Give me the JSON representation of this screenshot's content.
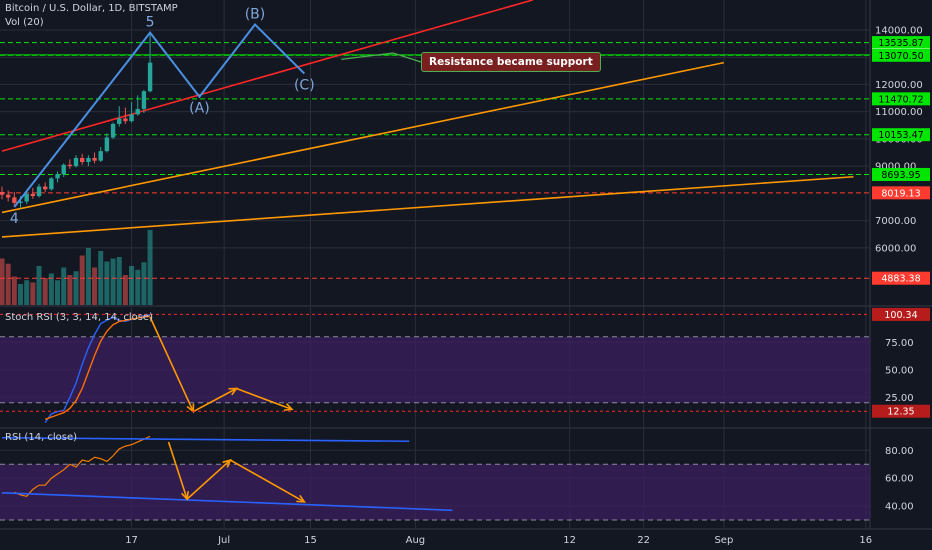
{
  "header": {
    "symbol_title": "Bitcoin / U.S. Dollar, 1D, BITSTAMP",
    "vol_label": "Vol (20)",
    "stoch_label": "Stoch RSI (3, 3, 14, 14, close)",
    "rsi_label": "RSI (14, close)"
  },
  "colors": {
    "background": "#131722",
    "grid": "#2a2e39",
    "up_candle": "#26a69a",
    "down_candle": "#ef5350",
    "green_level": "#00e600",
    "red_level": "#ff3b30",
    "channel_red": "#ff2626",
    "channel_orange": "#ff9800",
    "wave_line": "#4a90e2",
    "indicator_band": "#3b1f5e",
    "stoch_k": "#2962ff",
    "stoch_d": "#ff6d00",
    "rsi_line": "#f57c00",
    "projection_arrow": "#ff9800",
    "annotation_bg": "#7a1f1f"
  },
  "chart_data": {
    "type": "candlestick",
    "price_axis": {
      "ylim": [
        3900,
        15100
      ],
      "ticks": [
        6000,
        7000,
        9000,
        10000,
        11000,
        12000,
        13000,
        14000
      ],
      "tick_labels": [
        "6000.00",
        "7000.00",
        "9000.00",
        "10000.00",
        "11000.00",
        "12000.00",
        "13000.00",
        "14000.00"
      ]
    },
    "time_axis": {
      "labels": [
        "17",
        "Jul",
        "15",
        "Aug",
        "12",
        "22",
        "Sep",
        "16"
      ],
      "label_day": [
        21,
        36,
        50,
        67,
        92,
        104,
        117,
        140
      ]
    },
    "price_levels": [
      {
        "value": 13535.87,
        "label": "13535.87",
        "style": "green"
      },
      {
        "value": 13086.95,
        "label": "13086.95",
        "style": "green-solid"
      },
      {
        "value": 13070.5,
        "label": "13070.50",
        "style": "green"
      },
      {
        "value": 11470.72,
        "label": "11470.72",
        "style": "green"
      },
      {
        "value": 10153.47,
        "label": "10153.47",
        "style": "green"
      },
      {
        "value": 8693.95,
        "label": "8693.95",
        "style": "green"
      },
      {
        "value": 8019.13,
        "label": "8019.13",
        "style": "red"
      },
      {
        "value": 4883.38,
        "label": "4883.38",
        "style": "red"
      }
    ],
    "candles": [
      {
        "day": 0,
        "o": 8050,
        "h": 8250,
        "l": 7780,
        "c": 7950
      },
      {
        "day": 1,
        "o": 7950,
        "h": 8100,
        "l": 7700,
        "c": 7850
      },
      {
        "day": 2,
        "o": 7850,
        "h": 8050,
        "l": 7500,
        "c": 7650
      },
      {
        "day": 3,
        "o": 7650,
        "h": 7900,
        "l": 7450,
        "c": 7700
      },
      {
        "day": 4,
        "o": 7700,
        "h": 8100,
        "l": 7600,
        "c": 7980
      },
      {
        "day": 5,
        "o": 7980,
        "h": 8200,
        "l": 7800,
        "c": 7900
      },
      {
        "day": 6,
        "o": 7900,
        "h": 8350,
        "l": 7850,
        "c": 8250
      },
      {
        "day": 7,
        "o": 8250,
        "h": 8400,
        "l": 8050,
        "c": 8150
      },
      {
        "day": 8,
        "o": 8150,
        "h": 8600,
        "l": 8100,
        "c": 8550
      },
      {
        "day": 9,
        "o": 8550,
        "h": 8800,
        "l": 8400,
        "c": 8700
      },
      {
        "day": 10,
        "o": 8700,
        "h": 9100,
        "l": 8600,
        "c": 9050
      },
      {
        "day": 11,
        "o": 9050,
        "h": 9250,
        "l": 8900,
        "c": 9000
      },
      {
        "day": 12,
        "o": 9000,
        "h": 9400,
        "l": 8950,
        "c": 9300
      },
      {
        "day": 13,
        "o": 9300,
        "h": 9450,
        "l": 9050,
        "c": 9150
      },
      {
        "day": 14,
        "o": 9150,
        "h": 9400,
        "l": 9000,
        "c": 9300
      },
      {
        "day": 15,
        "o": 9300,
        "h": 9500,
        "l": 9100,
        "c": 9200
      },
      {
        "day": 16,
        "o": 9200,
        "h": 9700,
        "l": 9150,
        "c": 9550
      },
      {
        "day": 17,
        "o": 9550,
        "h": 10200,
        "l": 9500,
        "c": 10050
      },
      {
        "day": 18,
        "o": 10050,
        "h": 10600,
        "l": 10000,
        "c": 10550
      },
      {
        "day": 19,
        "o": 10550,
        "h": 11200,
        "l": 10450,
        "c": 10750
      },
      {
        "day": 20,
        "o": 10750,
        "h": 11150,
        "l": 10550,
        "c": 10650
      },
      {
        "day": 21,
        "o": 10650,
        "h": 11350,
        "l": 10600,
        "c": 10900
      },
      {
        "day": 22,
        "o": 10900,
        "h": 11600,
        "l": 10850,
        "c": 11100
      },
      {
        "day": 23,
        "o": 11100,
        "h": 11800,
        "l": 10950,
        "c": 11750
      },
      {
        "day": 24,
        "o": 11750,
        "h": 13900,
        "l": 11700,
        "c": 12800
      }
    ],
    "volume": [
      0.62,
      0.55,
      0.38,
      0.28,
      0.33,
      0.3,
      0.52,
      0.36,
      0.42,
      0.33,
      0.5,
      0.4,
      0.45,
      0.66,
      0.76,
      0.5,
      0.72,
      0.58,
      0.62,
      0.64,
      0.4,
      0.52,
      0.47,
      0.57,
      1.0
    ],
    "wave": {
      "points": [
        {
          "day": 2,
          "price": 7500,
          "label": "4"
        },
        {
          "day": 24,
          "price": 13900,
          "label": "5"
        },
        {
          "day": 32,
          "price": 11550,
          "label": "(A)"
        },
        {
          "day": 41,
          "price": 14200,
          "label": "(B)"
        },
        {
          "day": 49,
          "price": 12400,
          "label": "(C)"
        }
      ]
    },
    "trendlines": [
      {
        "name": "channel-red",
        "p1": {
          "day": 0,
          "price": 9550
        },
        "p2": {
          "day": 86,
          "price": 15100
        }
      },
      {
        "name": "channel-orange-upper",
        "p1": {
          "day": 0,
          "price": 7300
        },
        "p2": {
          "day": 117,
          "price": 12800
        }
      },
      {
        "name": "channel-orange-lower",
        "p1": {
          "day": 0,
          "price": 6400
        },
        "p2": {
          "day": 138,
          "price": 8610
        }
      }
    ],
    "annotation": {
      "text": "Resistance became support",
      "anchor_day": 55,
      "anchor_price": 12920
    },
    "stoch_rsi": {
      "ylim": [
        -2,
        108
      ],
      "ticks": [
        25,
        50,
        75
      ],
      "tick_labels": [
        "25.00",
        "50.00",
        "75.00"
      ],
      "bands": [
        20,
        80
      ],
      "last_values": [
        {
          "value": 100.34,
          "label": "100.34"
        },
        {
          "value": 12.35,
          "label": "12.35"
        }
      ],
      "k": [
        2,
        10,
        12,
        13,
        25,
        38,
        55,
        70,
        82,
        92,
        95,
        98,
        95,
        94,
        96,
        97,
        99,
        100
      ],
      "d": [
        5,
        7,
        9,
        11,
        15,
        22,
        33,
        48,
        63,
        76,
        85,
        91,
        94,
        95,
        96,
        97,
        98,
        99
      ],
      "projection": [
        {
          "day": 24,
          "value": 98
        },
        {
          "day": 31,
          "value": 12
        },
        {
          "day": 38,
          "value": 33
        },
        {
          "day": 47,
          "value": 14
        }
      ]
    },
    "rsi": {
      "ylim": [
        25,
        96
      ],
      "ticks": [
        40,
        60,
        80
      ],
      "tick_labels": [
        "40.00",
        "60.00",
        "80.00"
      ],
      "bands": [
        30,
        70
      ],
      "values": [
        50,
        48,
        47,
        52,
        55,
        55,
        60,
        63,
        66,
        70,
        68,
        73,
        72,
        75,
        74,
        72,
        76,
        81,
        83,
        84,
        86,
        88,
        90
      ],
      "trendline_upper": {
        "p1": {
          "day": 0,
          "price": 89
        },
        "p2": {
          "day": 66,
          "price": 86.5
        }
      },
      "trendline_lower": {
        "p1": {
          "day": 0,
          "price": 49.5
        },
        "p2": {
          "day": 73,
          "price": 37
        }
      },
      "projection": [
        {
          "day": 27,
          "value": 86
        },
        {
          "day": 30,
          "value": 45
        },
        {
          "day": 37,
          "value": 73
        },
        {
          "day": 49,
          "value": 43
        }
      ]
    }
  }
}
